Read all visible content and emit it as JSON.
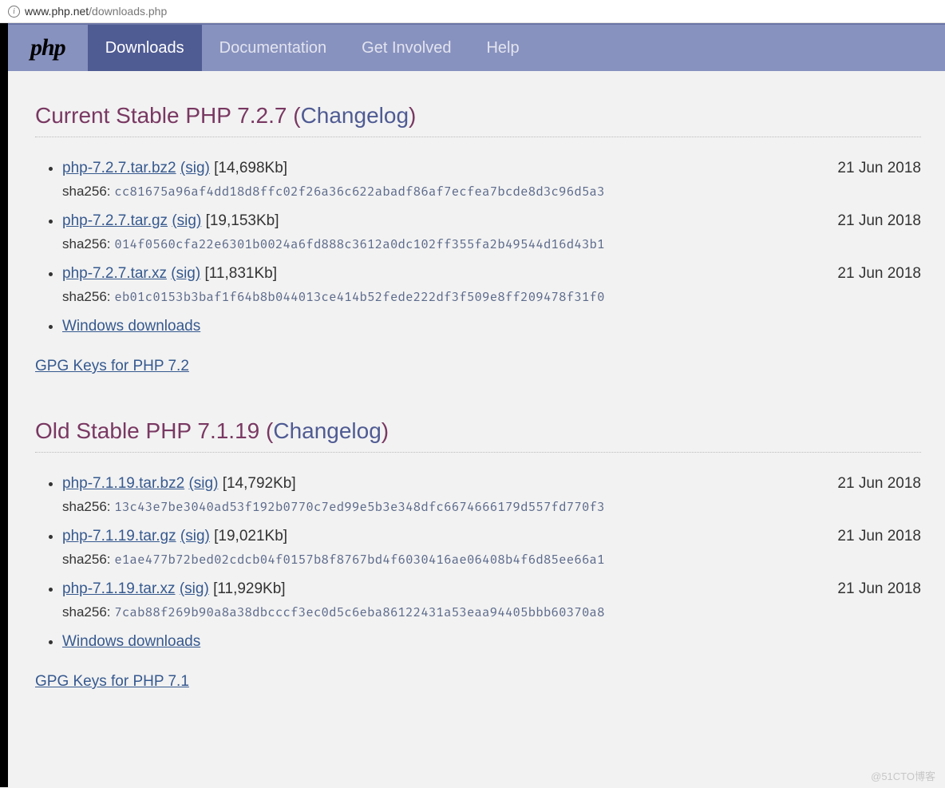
{
  "addressBar": {
    "host": "www.php.net",
    "path": "/downloads.php"
  },
  "brand": "php",
  "nav": [
    {
      "label": "Downloads",
      "selected": true
    },
    {
      "label": "Documentation",
      "selected": false
    },
    {
      "label": "Get Involved",
      "selected": false
    },
    {
      "label": "Help",
      "selected": false
    }
  ],
  "sections": [
    {
      "titlePrefix": "Current Stable ",
      "version": "PHP 7.2.7",
      "changelogLabel": "Changelog",
      "files": [
        {
          "name": "php-7.2.7.tar.bz2",
          "sig": "(sig)",
          "size": "[14,698Kb]",
          "date": "21 Jun 2018",
          "shaLabel": "sha256:",
          "sha": "cc81675a96af4dd18d8ffc02f26a36c622abadf86af7ecfea7bcde8d3c96d5a3"
        },
        {
          "name": "php-7.2.7.tar.gz",
          "sig": "(sig)",
          "size": "[19,153Kb]",
          "date": "21 Jun 2018",
          "shaLabel": "sha256:",
          "sha": "014f0560cfa22e6301b0024a6fd888c3612a0dc102ff355fa2b49544d16d43b1"
        },
        {
          "name": "php-7.2.7.tar.xz",
          "sig": "(sig)",
          "size": "[11,831Kb]",
          "date": "21 Jun 2018",
          "shaLabel": "sha256:",
          "sha": "eb01c0153b3baf1f64b8b044013ce414b52fede222df3f509e8ff209478f31f0"
        }
      ],
      "windowsLabel": "Windows downloads",
      "gpgLabel": "GPG Keys for PHP 7.2"
    },
    {
      "titlePrefix": "Old Stable ",
      "version": "PHP 7.1.19",
      "changelogLabel": "Changelog",
      "files": [
        {
          "name": "php-7.1.19.tar.bz2",
          "sig": "(sig)",
          "size": "[14,792Kb]",
          "date": "21 Jun 2018",
          "shaLabel": "sha256:",
          "sha": "13c43e7be3040ad53f192b0770c7ed99e5b3e348dfc6674666179d557fd770f3"
        },
        {
          "name": "php-7.1.19.tar.gz",
          "sig": "(sig)",
          "size": "[19,021Kb]",
          "date": "21 Jun 2018",
          "shaLabel": "sha256:",
          "sha": "e1ae477b72bed02cdcb04f0157b8f8767bd4f6030416ae06408b4f6d85ee66a1"
        },
        {
          "name": "php-7.1.19.tar.xz",
          "sig": "(sig)",
          "size": "[11,929Kb]",
          "date": "21 Jun 2018",
          "shaLabel": "sha256:",
          "sha": "7cab88f269b90a8a38dbcccf3ec0d5c6eba86122431a53eaa94405bbb60370a8"
        }
      ],
      "windowsLabel": "Windows downloads",
      "gpgLabel": "GPG Keys for PHP 7.1"
    }
  ],
  "watermark": "@51CTO博客"
}
